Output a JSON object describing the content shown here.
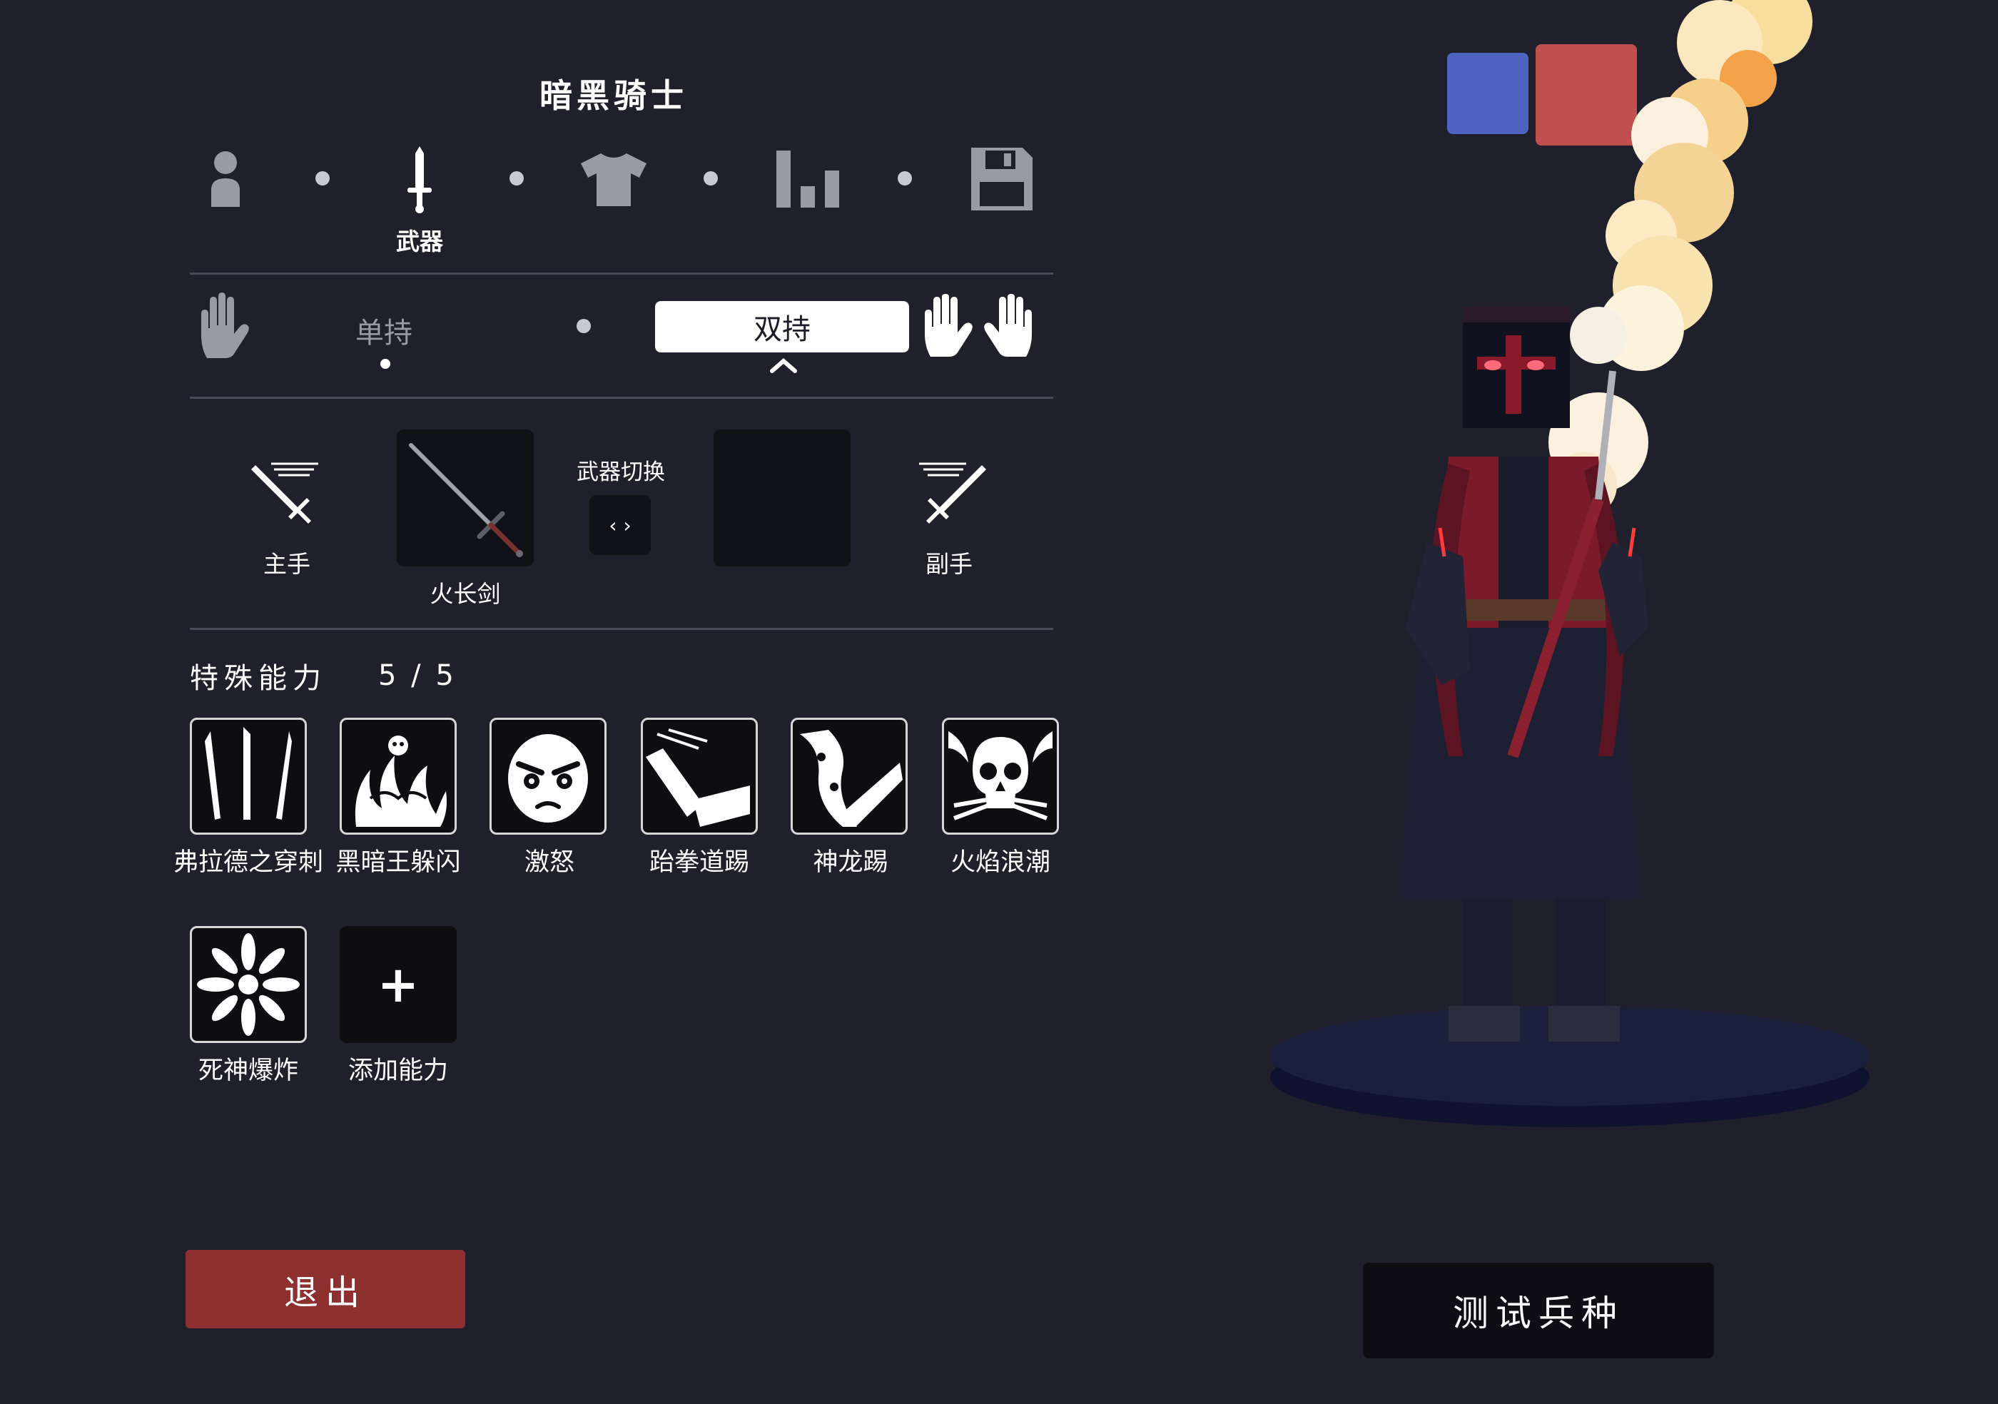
{
  "unit": {
    "name": "暗黑骑士"
  },
  "editor_steps": [
    {
      "id": "body",
      "icon": "person-icon"
    },
    {
      "id": "weapons",
      "icon": "sword-icon",
      "label": "武器"
    },
    {
      "id": "clothing",
      "icon": "shirt-icon"
    },
    {
      "id": "stats",
      "icon": "bar-chart-icon"
    },
    {
      "id": "save",
      "icon": "floppy-disk-icon"
    }
  ],
  "grip": {
    "one_handed_label": "单持",
    "two_handed_label": "双持",
    "selected": "双持"
  },
  "weapons": {
    "main_hand_label": "主手",
    "main_weapon_name": "火长剑",
    "switch_label": "武器切换",
    "switch_glyph": "‹ ›",
    "off_hand_label": "副手"
  },
  "abilities": {
    "title": "特殊能力",
    "count": "5 / 5",
    "items": [
      {
        "label": "弗拉德之穿刺",
        "icon": "stakes-icon"
      },
      {
        "label": "黑暗王躲闪",
        "icon": "dark-dodge-icon"
      },
      {
        "label": "激怒",
        "icon": "angry-face-icon"
      },
      {
        "label": "跆拳道踢",
        "icon": "kick-icon"
      },
      {
        "label": "神龙踢",
        "icon": "dragon-kick-icon"
      },
      {
        "label": "火焰浪潮",
        "icon": "skull-wave-icon"
      },
      {
        "label": "死神爆炸",
        "icon": "explosion-icon"
      }
    ],
    "add_label": "添加能力",
    "add_glyph": "+"
  },
  "buttons": {
    "exit": "退出",
    "test": "测试兵种"
  },
  "colors": {
    "background": "#20202c",
    "team_blue": "#4f64c0",
    "team_red": "#c24f50",
    "exit": "#8e3030",
    "panel": "#111118"
  }
}
